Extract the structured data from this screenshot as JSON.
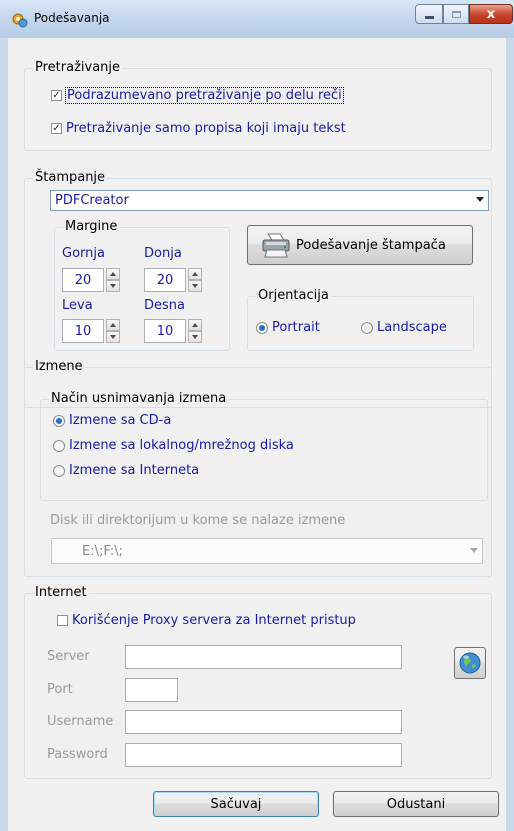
{
  "window": {
    "title": "Podešavanja",
    "close_glyph": "x"
  },
  "search": {
    "title": "Pretraživanje",
    "options": [
      {
        "label": "Podrazumevano pretraživanje po delu reči",
        "checked": true
      },
      {
        "label": "Pretraživanje samo propisa koji imaju tekst",
        "checked": true
      }
    ]
  },
  "printing": {
    "title": "Štampanje",
    "printer": "PDFCreator",
    "margins": {
      "title": "Margine",
      "top_label": "Gornja",
      "top_value": "20",
      "bottom_label": "Donja",
      "bottom_value": "20",
      "left_label": "Leva",
      "left_value": "10",
      "right_label": "Desna",
      "right_value": "10"
    },
    "setup_button": "Podešavanje štampača",
    "orientation": {
      "title": "Orjentacija",
      "portrait": "Portrait",
      "landscape": "Landscape",
      "selected": "portrait"
    }
  },
  "updates": {
    "title": "Izmene",
    "method": {
      "title": "Način usnimavanja izmena",
      "options": [
        {
          "label": "Izmene sa CD-a",
          "selected": true
        },
        {
          "label": "Izmene sa lokalnog/mrežnog diska",
          "selected": false
        },
        {
          "label": "Izmene sa Interneta",
          "selected": false
        }
      ]
    },
    "disk_label": "Disk ili direktorijum u kome se nalaze izmene",
    "disk_value": "E:\\;F:\\;"
  },
  "internet": {
    "title": "Internet",
    "proxy_label": "Korišćenje Proxy servera za Internet pristup",
    "proxy_checked": false,
    "server_label": "Server",
    "port_label": "Port",
    "username_label": "Username",
    "password_label": "Password"
  },
  "footer": {
    "save": "Sačuvaj",
    "cancel": "Odustani"
  },
  "icons": {
    "app": "gear-globe-icon",
    "printer": "printer-icon",
    "globe": "globe-icon"
  },
  "colors": {
    "text_blue": "#1a1aa5",
    "title_bar": "#c4d6ec",
    "radio_dot": "#2470c8"
  }
}
